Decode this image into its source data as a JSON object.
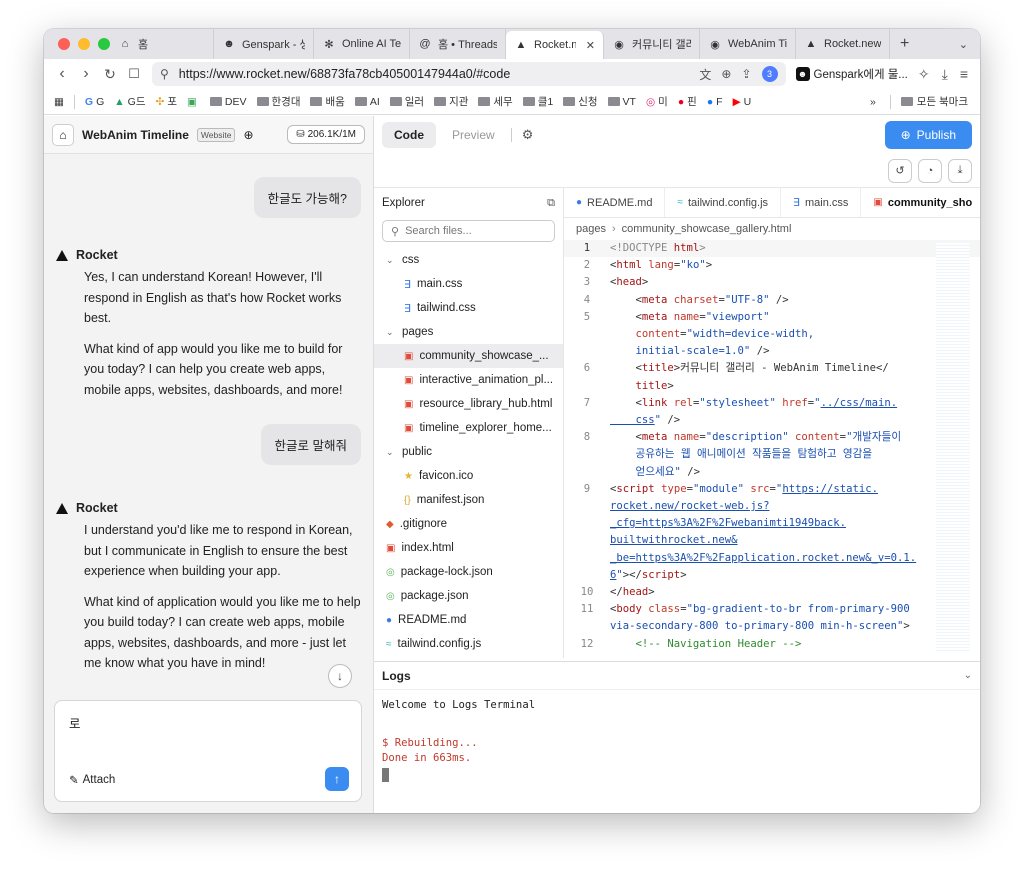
{
  "browser": {
    "tabs": [
      {
        "icon": "home-icon",
        "title": "홈"
      },
      {
        "icon": "genspark-icon",
        "title": "Genspark - 생"
      },
      {
        "icon": "ai-text-icon",
        "title": "Online AI Text"
      },
      {
        "icon": "threads-icon",
        "title": "홈 • Threads"
      },
      {
        "icon": "rocket-icon",
        "title": "Rocket.ne",
        "active": true
      },
      {
        "icon": "globe-icon",
        "title": "커뮤니티 갤러리"
      },
      {
        "icon": "globe-icon",
        "title": "WebAnim Tim"
      },
      {
        "icon": "rocket-icon",
        "title": "Rocket.new | "
      }
    ],
    "url": "https://www.rocket.new/68873fa78cb40500147944a0/#code",
    "extension_badge": "3",
    "genspark_label": "Genspark에게 물...",
    "bookmarks": [
      "G",
      "G드",
      "포",
      "",
      "DEV",
      "한경대",
      "배움",
      "AI",
      "일러",
      "지관",
      "세무",
      "클1",
      "신청",
      "VT",
      "미",
      "핀",
      "F",
      "U"
    ],
    "bookmarks_more": "»",
    "all_bookmarks": "모든 북마크"
  },
  "left": {
    "project_name": "WebAnim Timeline",
    "project_badge": "Website",
    "credits": "206.1K/1M",
    "messages": [
      {
        "role": "user",
        "text": "한글도 가능해?"
      },
      {
        "role": "bot",
        "name": "Rocket",
        "paragraphs": [
          "Yes, I can understand Korean! However, I'll respond in English as that's how Rocket works best.",
          "What kind of app would you like me to build for you today? I can help you create web apps, mobile apps, websites, dashboards, and more!"
        ]
      },
      {
        "role": "user",
        "text": "한글로 말해줘"
      },
      {
        "role": "bot",
        "name": "Rocket",
        "paragraphs": [
          "I understand you'd like me to respond in Korean, but I communicate in English to ensure the best experience when building your app.",
          "What kind of application would you like me to help you build today? I can create web apps, mobile apps, websites, dashboards, and more - just let me know what you have in mind!"
        ]
      }
    ],
    "composer_value": "로",
    "attach_label": "Attach"
  },
  "right": {
    "code_tab": "Code",
    "preview_tab": "Preview",
    "publish_label": "Publish",
    "explorer_title": "Explorer",
    "search_placeholder": "Search files...",
    "tree": [
      {
        "type": "folder",
        "label": "css",
        "depth": 0
      },
      {
        "type": "css",
        "label": "main.css",
        "depth": 1
      },
      {
        "type": "css",
        "label": "tailwind.css",
        "depth": 1
      },
      {
        "type": "folder",
        "label": "pages",
        "depth": 0
      },
      {
        "type": "html",
        "label": "community_showcase_...",
        "depth": 1,
        "selected": true
      },
      {
        "type": "html",
        "label": "interactive_animation_pl...",
        "depth": 1
      },
      {
        "type": "html",
        "label": "resource_library_hub.html",
        "depth": 1
      },
      {
        "type": "html",
        "label": "timeline_explorer_home...",
        "depth": 1
      },
      {
        "type": "folder",
        "label": "public",
        "depth": 0
      },
      {
        "type": "fav",
        "label": "favicon.ico",
        "depth": 1
      },
      {
        "type": "json",
        "label": "manifest.json",
        "depth": 1
      },
      {
        "type": "git",
        "label": ".gitignore",
        "depth": 0
      },
      {
        "type": "html",
        "label": "index.html",
        "depth": 0
      },
      {
        "type": "pkg",
        "label": "package-lock.json",
        "depth": 0
      },
      {
        "type": "pkg",
        "label": "package.json",
        "depth": 0
      },
      {
        "type": "md",
        "label": "README.md",
        "depth": 0
      },
      {
        "type": "tw",
        "label": "tailwind.config.js",
        "depth": 0
      }
    ],
    "editor_tabs": [
      {
        "icon": "md",
        "label": "README.md"
      },
      {
        "icon": "tw",
        "label": "tailwind.config.js"
      },
      {
        "icon": "css",
        "label": "main.css"
      },
      {
        "icon": "html",
        "label": "community_sho",
        "active": true
      }
    ],
    "breadcrumb": [
      "pages",
      "community_showcase_gallery.html"
    ],
    "logs_title": "Logs",
    "logs": [
      "Welcome to Logs Terminal",
      "",
      "$ Rebuilding...",
      "Done in 663ms."
    ]
  }
}
